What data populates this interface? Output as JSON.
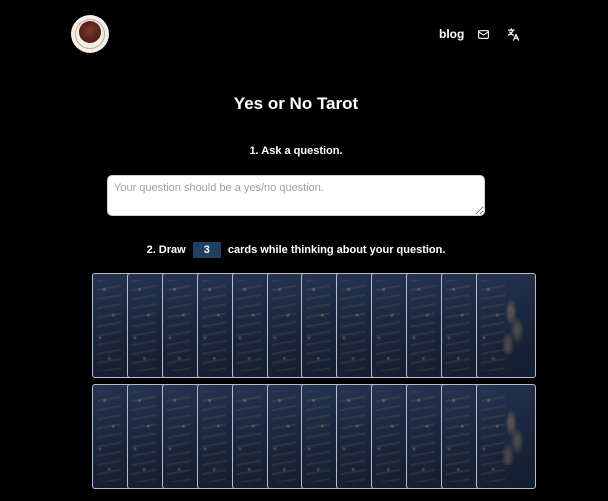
{
  "header": {
    "logo_alt": "Yes or No Tarot logo",
    "nav": {
      "blog_label": "blog",
      "mail_icon": "mail-icon",
      "language_icon": "translate-icon"
    }
  },
  "main": {
    "title": "Yes or No Tarot",
    "step1_label": "1. Ask a question.",
    "question": {
      "value": "",
      "placeholder": "Your question should be a yes/no question."
    },
    "step2": {
      "prefix": "2. Draw",
      "count": "3",
      "suffix": "cards while thinking about your question."
    },
    "deck": {
      "rows": 2,
      "cards_per_row": 12
    }
  },
  "colors": {
    "background": "#000000",
    "count_badge": "#1f4160",
    "card_back": "#1b2740",
    "card_border": "#b8bcc4"
  }
}
